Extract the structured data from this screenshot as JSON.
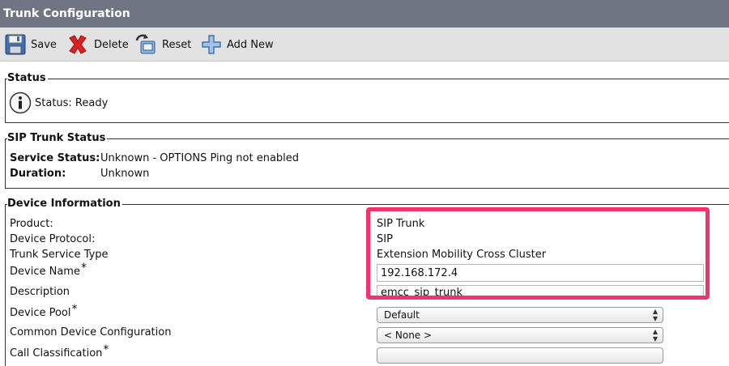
{
  "title": "Trunk Configuration",
  "toolbar": {
    "save_label": "Save",
    "delete_label": "Delete",
    "reset_label": "Reset",
    "add_new_label": "Add New"
  },
  "status": {
    "legend": "Status",
    "text": "Status: Ready",
    "icon": "info-icon"
  },
  "sip_trunk_status": {
    "legend": "SIP Trunk Status",
    "service_status_label": "Service Status:",
    "service_status_value": "Unknown - OPTIONS Ping not enabled",
    "duration_label": "Duration:",
    "duration_value": "Unknown"
  },
  "device_info": {
    "legend": "Device Information",
    "product_label": "Product:",
    "product_value": "SIP Trunk",
    "protocol_label": "Device Protocol:",
    "protocol_value": "SIP",
    "service_type_label": "Trunk Service Type",
    "service_type_value": "Extension Mobility Cross Cluster",
    "device_name_label": "Device Name",
    "device_name_value": "192.168.172.4",
    "description_label": "Description",
    "description_value": "emcc_sip_trunk",
    "device_pool_label": "Device Pool",
    "device_pool_value": "Default",
    "common_config_label": "Common Device Configuration",
    "common_config_value": "< None >",
    "call_class_label": "Call Classification"
  },
  "colors": {
    "titlebar": "#707584",
    "toolbar": "#e2e2e2",
    "highlight": "#f4336d"
  }
}
